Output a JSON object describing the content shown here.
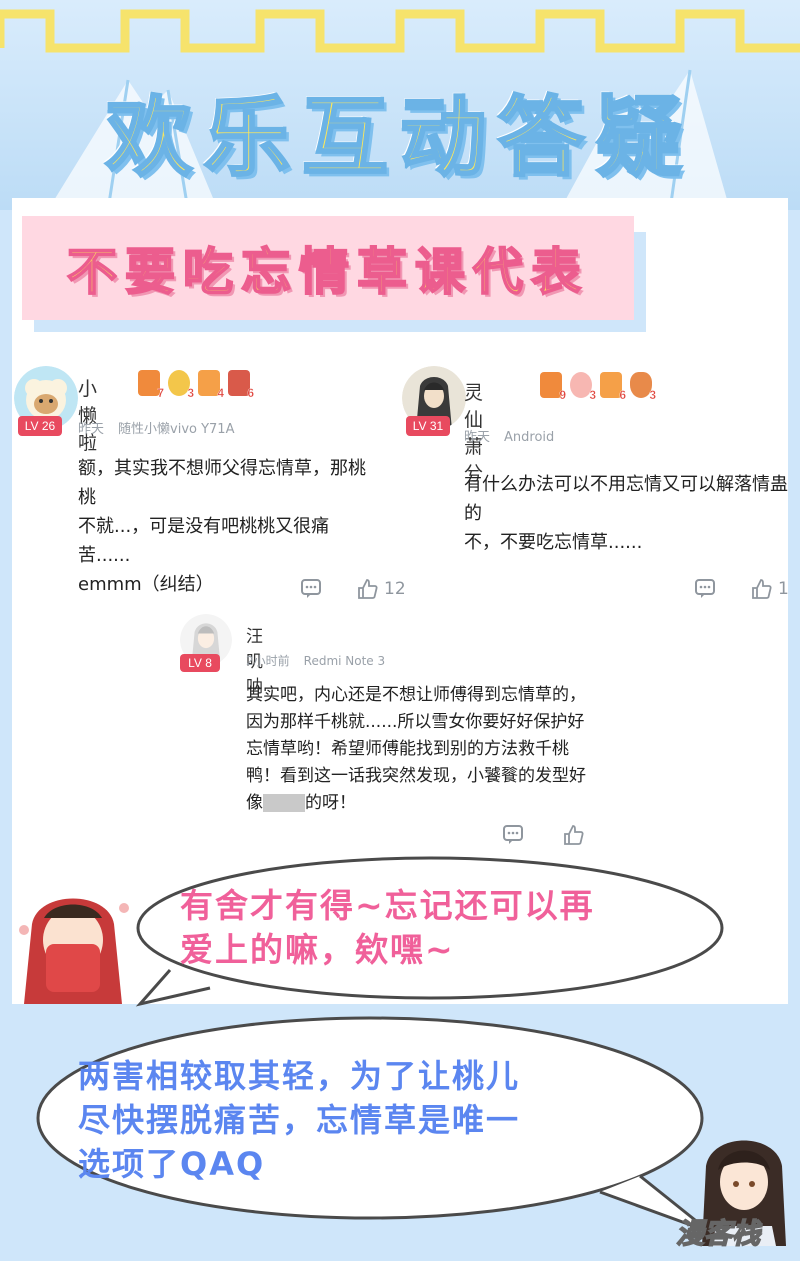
{
  "header": {
    "title": "欢乐互动答疑"
  },
  "topic": {
    "title": "不要吃忘情草课代表"
  },
  "comments": [
    {
      "username": "小懒啦",
      "level": "LV 26",
      "badges": [
        {
          "icon": "gift-box-icon",
          "count": "7"
        },
        {
          "icon": "medal-icon",
          "count": "3"
        },
        {
          "icon": "bottles-icon",
          "count": "4"
        },
        {
          "icon": "books-icon",
          "count": "6"
        }
      ],
      "time": "昨天",
      "device": "随性小懒vivo Y71A",
      "text_lines": [
        "额，其实我不想师父得忘情草，那桃桃",
        "不就...，可是没有吧桃桃又很痛苦......",
        "emmm（纠结）"
      ],
      "likes": "12"
    },
    {
      "username": "灵仙萧兮",
      "level": "LV 31",
      "badges": [
        {
          "icon": "gift-box-icon",
          "count": "9"
        },
        {
          "icon": "pig-face-icon",
          "count": "3"
        },
        {
          "icon": "bottles-icon",
          "count": "6"
        },
        {
          "icon": "money-bag-icon",
          "count": "3"
        }
      ],
      "time": "昨天",
      "device": "Android",
      "text_lines": [
        "有什么办法可以不用忘情又可以解落情蛊的",
        "不，不要吃忘情草......"
      ],
      "likes": "1"
    },
    {
      "username": "汪叽呐",
      "level": "LV 8",
      "time": "2小时前",
      "device": "Redmi Note 3",
      "text_lines": [
        "其实吧，内心还是不想让师傅得到忘情草的，",
        "因为那样千桃就......所以雪女你要好好保护好",
        "忘情草哟！希望师傅能找到别的方法救千桃",
        "鸭！看到这一话我突然发现，小饕餮的发型好"
      ],
      "last_line_before": "像",
      "last_line_after": "的呀！"
    }
  ],
  "bubbles": [
    {
      "lines": [
        "有舍才有得~忘记还可以再",
        "爱上的嘛，欸嘿~"
      ],
      "color": "#f0609a"
    },
    {
      "lines": [
        "两害相较取其轻，为了让桃儿",
        "尽快摆脱痛苦，忘情草是唯一",
        "选项了QAQ"
      ],
      "color": "#5b86f0"
    }
  ],
  "watermark": "漫客栈",
  "colors": {
    "background": "#cfe6fa",
    "title_fill": "#fde75a",
    "title_outline": "#6bb3e6",
    "topic_box": "#ffd8e2",
    "level_badge": "#e84a5f"
  }
}
